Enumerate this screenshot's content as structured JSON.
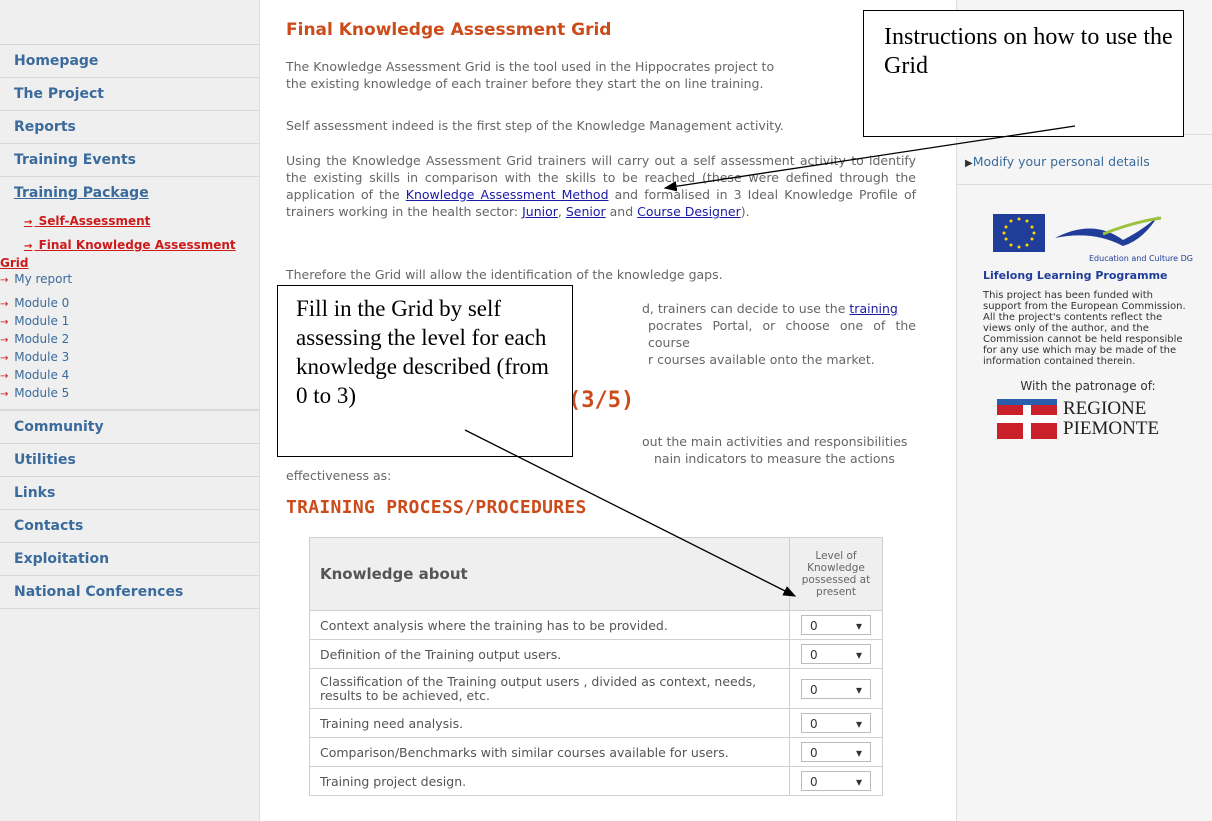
{
  "nav": {
    "items_top": [
      "Homepage",
      "The Project",
      "Reports",
      "Training Events"
    ],
    "training_package": "Training Package",
    "sub_items": {
      "self_assessment": "Self-Assessment",
      "final_grid_line1": "Final Knowledge Assessment",
      "final_grid_line2": "Grid",
      "my_report": "My report",
      "modules": [
        "Module 0",
        "Module 1",
        "Module 2",
        "Module 3",
        "Module 4",
        "Module 5"
      ]
    },
    "items_bottom": [
      "Community",
      "Utilities",
      "Links",
      "Contacts",
      "Exploitation",
      "National Conferences"
    ]
  },
  "main": {
    "title": "Final Knowledge Assessment Grid",
    "para1": "The Knowledge Assessment Grid is the tool used in the Hippocrates project to",
    "para1b": "the existing knowledge of each trainer before they start the on line training.",
    "para2": "Self assessment indeed is the first step of the Knowledge Management activity.",
    "para3_a": "Using the Knowledge Assessment Grid trainers will carry out a self assessment activity to identify the existing skills in comparison with the skills to be reached (these were defined through the application of the ",
    "para3_link1": "Knowledge Assessment Method",
    "para3_b": " and formalised in 3 Ideal Knowledge Profile of trainers working in the health sector: ",
    "para3_link2": "Junior",
    "para3_c": ", ",
    "para3_link3": "Senior",
    "para3_d": " and ",
    "para3_link4": "Course Designer",
    "para3_e": ").",
    "para4": "Therefore the Grid will allow the identification of the knowledge gaps.",
    "para5_a": "d, trainers can decide to use the ",
    "para5_link": "training",
    "para5_b": "pocrates Portal, or choose one of the course",
    "para5_c": "r courses available onto the market.",
    "partial_head": "(3/5)",
    "para6_a": "out the main activities and responsibilities",
    "para6_b": "nain indicators to measure the actions",
    "para6_c": "effectiveness as:",
    "section_title": "TRAINING PROCESS/PROCEDURES",
    "table": {
      "col1": "Knowledge about",
      "col2": "Level of Knowledge possessed at present",
      "rows": [
        {
          "text": "Context analysis where the training has to be provided.",
          "level": "0"
        },
        {
          "text": "Definition of the Training output users.",
          "level": "0"
        },
        {
          "text": "Classification of the Training output users , divided as context, needs, results to be achieved, etc.",
          "level": "0"
        },
        {
          "text": "Training need analysis.",
          "level": "0"
        },
        {
          "text": "Comparison/Benchmarks with similar courses available for users.",
          "level": "0"
        },
        {
          "text": "Training project design.",
          "level": "0"
        }
      ]
    }
  },
  "right": {
    "modify_link": "Modify your personal details",
    "eu_caption": "Education and Culture DG",
    "llp": "Lifelong Learning Programme",
    "funding_note": "This project has been funded with support from the European Commission.",
    "disclaimer": "All the project's contents reflect the views only of the author, and the Commission cannot be held responsible for any use which may be made of the information contained therein.",
    "patronage": "With the patronage of:",
    "region_line1": "REGIONE",
    "region_line2": "PIEMONTE"
  },
  "callouts": {
    "instructions": "Instructions on how to use the Grid",
    "fill": "Fill in the Grid by self assessing the level for each knowledge described (from 0 to 3)"
  }
}
